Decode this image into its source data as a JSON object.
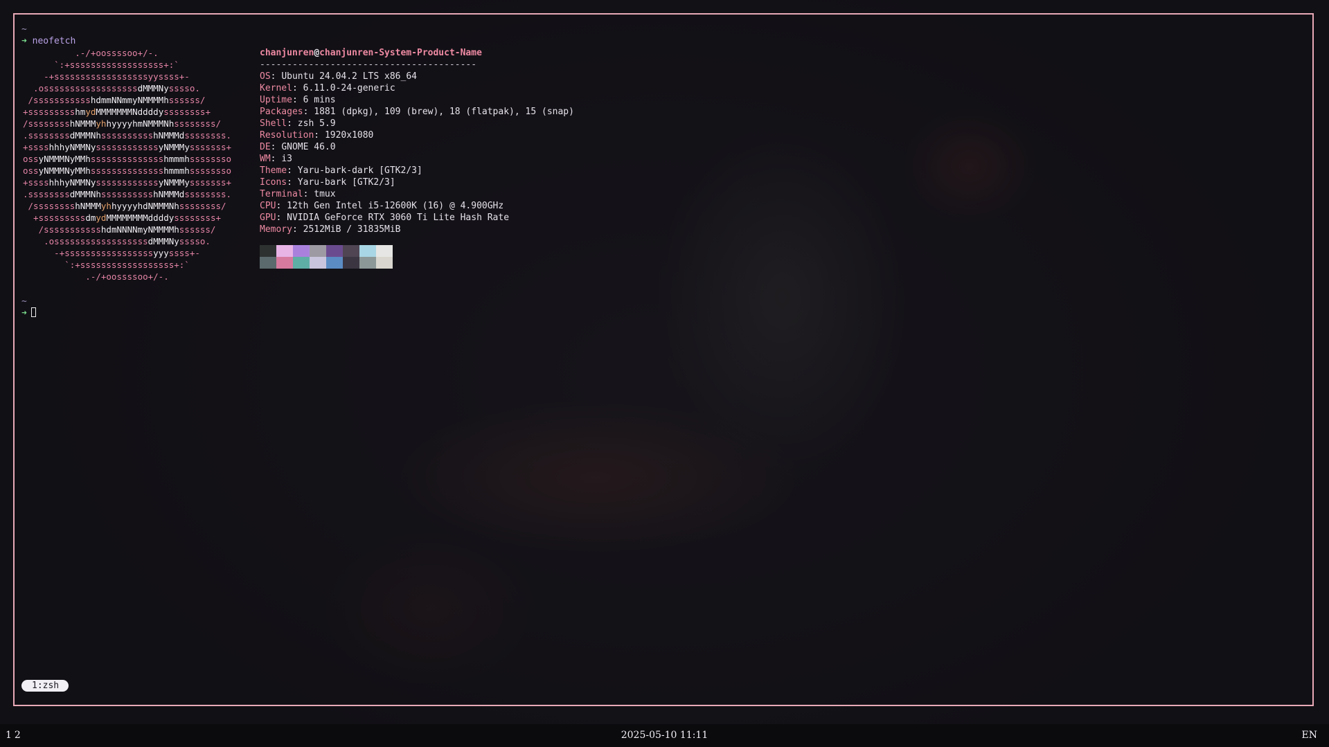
{
  "terminal": {
    "prompt_dir": "~",
    "prompt_arrow": "➜",
    "command": "neofetch",
    "ascii_logo": [
      [
        [
          "n",
          "          .-/+oossssoo+/-."
        ]
      ],
      [
        [
          "n",
          "      `:+ssssssssssssssssss+:`"
        ]
      ],
      [
        [
          "n",
          "    -+ssssssssssssssssssyyssss+-"
        ]
      ],
      [
        [
          "n",
          "  .ossssssssssssssssss"
        ],
        [
          "b",
          "dMMMNy"
        ],
        [
          "n",
          "sssso."
        ]
      ],
      [
        [
          "n",
          " /sssssssssss"
        ],
        [
          "b",
          "hdmmNNmmyNMMMMh"
        ],
        [
          "n",
          "ssssss/"
        ]
      ],
      [
        [
          "n",
          "+sssssssss"
        ],
        [
          "b",
          "hm"
        ],
        [
          "y",
          "yd"
        ],
        [
          "b",
          "MMMMMMMNddddy"
        ],
        [
          "n",
          "ssssssss+"
        ]
      ],
      [
        [
          "n",
          "/ssssssss"
        ],
        [
          "b",
          "hNMMM"
        ],
        [
          "y",
          "yh"
        ],
        [
          "b",
          "hyyyyhmNMMMNh"
        ],
        [
          "n",
          "ssssssss/"
        ]
      ],
      [
        [
          "n",
          ".ssssssss"
        ],
        [
          "b",
          "dMMMNh"
        ],
        [
          "n",
          "ssssssssss"
        ],
        [
          "b",
          "hNMMMd"
        ],
        [
          "n",
          "ssssssss."
        ]
      ],
      [
        [
          "n",
          "+ssss"
        ],
        [
          "b",
          "hhhyNMMNy"
        ],
        [
          "n",
          "ssssssssssss"
        ],
        [
          "b",
          "yNMMMy"
        ],
        [
          "n",
          "sssssss+"
        ]
      ],
      [
        [
          "n",
          "oss"
        ],
        [
          "b",
          "yNMMMNyMMh"
        ],
        [
          "n",
          "ssssssssssssss"
        ],
        [
          "b",
          "hmmmh"
        ],
        [
          "n",
          "ssssssso"
        ]
      ],
      [
        [
          "n",
          "oss"
        ],
        [
          "b",
          "yNMMMNyMMh"
        ],
        [
          "n",
          "ssssssssssssss"
        ],
        [
          "b",
          "hmmmh"
        ],
        [
          "n",
          "ssssssso"
        ]
      ],
      [
        [
          "n",
          "+ssss"
        ],
        [
          "b",
          "hhhyNMMNy"
        ],
        [
          "n",
          "ssssssssssss"
        ],
        [
          "b",
          "yNMMMy"
        ],
        [
          "n",
          "sssssss+"
        ]
      ],
      [
        [
          "n",
          ".ssssssss"
        ],
        [
          "b",
          "dMMMNh"
        ],
        [
          "n",
          "ssssssssss"
        ],
        [
          "b",
          "hNMMMd"
        ],
        [
          "n",
          "ssssssss."
        ]
      ],
      [
        [
          "n",
          " /ssssssss"
        ],
        [
          "b",
          "hNMMM"
        ],
        [
          "y",
          "yh"
        ],
        [
          "b",
          "hyyyyhdNMMMNh"
        ],
        [
          "n",
          "ssssssss/"
        ]
      ],
      [
        [
          "n",
          "  +sssssssss"
        ],
        [
          "b",
          "dm"
        ],
        [
          "y",
          "yd"
        ],
        [
          "b",
          "MMMMMMMMddddy"
        ],
        [
          "n",
          "ssssssss+"
        ]
      ],
      [
        [
          "n",
          "   /sssssssssss"
        ],
        [
          "b",
          "hdmNNNNmyNMMMMh"
        ],
        [
          "n",
          "ssssss/"
        ]
      ],
      [
        [
          "n",
          "    .ossssssssssssssssss"
        ],
        [
          "b",
          "dMMMNy"
        ],
        [
          "n",
          "sssso."
        ]
      ],
      [
        [
          "n",
          "      -+sssssssssssssssss"
        ],
        [
          "b",
          "yyy"
        ],
        [
          "n",
          "ssss+-"
        ]
      ],
      [
        [
          "n",
          "        `:+ssssssssssssssssss+:`"
        ]
      ],
      [
        [
          "n",
          "            .-/+oossssoo+/-."
        ]
      ]
    ],
    "user": "chanjunren",
    "at": "@",
    "host": "chanjunren-System-Product-Name",
    "separator": "----------------------------------------",
    "info": [
      {
        "key": "OS",
        "value": "Ubuntu 24.04.2 LTS x86_64"
      },
      {
        "key": "Kernel",
        "value": "6.11.0-24-generic"
      },
      {
        "key": "Uptime",
        "value": "6 mins"
      },
      {
        "key": "Packages",
        "value": "1881 (dpkg), 109 (brew), 18 (flatpak), 15 (snap)"
      },
      {
        "key": "Shell",
        "value": "zsh 5.9"
      },
      {
        "key": "Resolution",
        "value": "1920x1080"
      },
      {
        "key": "DE",
        "value": "GNOME 46.0"
      },
      {
        "key": "WM",
        "value": "i3"
      },
      {
        "key": "Theme",
        "value": "Yaru-bark-dark [GTK2/3]"
      },
      {
        "key": "Icons",
        "value": "Yaru-bark [GTK2/3]"
      },
      {
        "key": "Terminal",
        "value": "tmux"
      },
      {
        "key": "CPU",
        "value": "12th Gen Intel i5-12600K (16) @ 4.900GHz"
      },
      {
        "key": "GPU",
        "value": "NVIDIA GeForce RTX 3060 Ti Lite Hash Rate"
      },
      {
        "key": "Memory",
        "value": "2512MiB / 31835MiB"
      }
    ],
    "palette_top": [
      "#2d3231",
      "#e8b4e6",
      "#a981dd",
      "#9e9aa3",
      "#6b4b8f",
      "#4f4553",
      "#a9d6e4",
      "#e6e6e4"
    ],
    "palette_bottom": [
      "#5b6a6c",
      "#d77aa0",
      "#5eaea6",
      "#c9c5de",
      "#5b8cc4",
      "#3b3541",
      "#8c9897",
      "#d8d6ce"
    ],
    "tmux_window": "1:zsh"
  },
  "statusbar": {
    "workspaces": [
      "1",
      "2"
    ],
    "datetime": "2025-05-10 11:11",
    "keyboard_layout": "EN"
  }
}
